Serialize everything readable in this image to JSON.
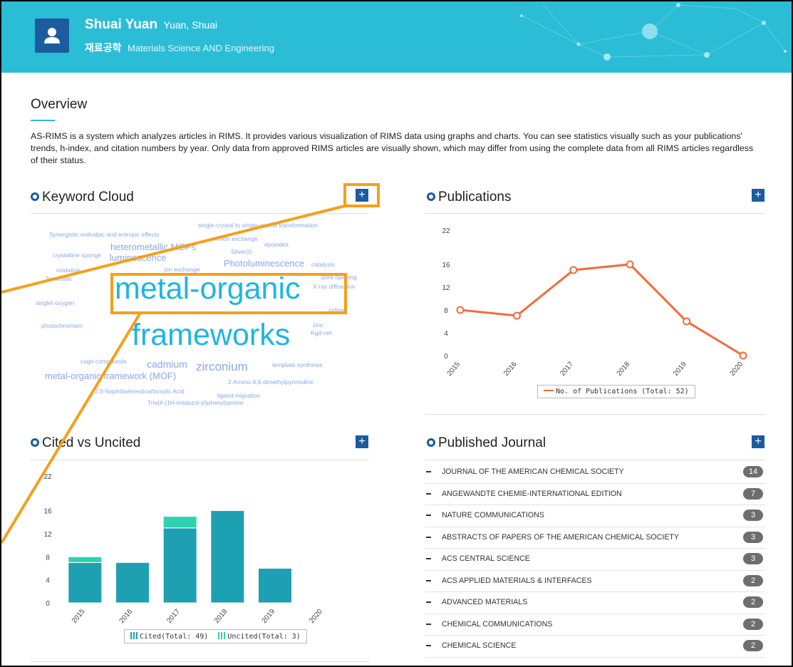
{
  "header": {
    "name": "Shuai Yuan",
    "name_alt": "Yuan, Shuai",
    "dept_kr": "재료공학",
    "dept_en": "Materials Science AND Engineering",
    "avatar_icon": "user-icon",
    "background_color": "#2cbdd6"
  },
  "overview": {
    "title": "Overview",
    "text": "AS-RIMS is a system which analyzes articles in RIMS. It provides various visualization of RIMS data using graphs and charts. You can see statistics visually such as your publications' trends, h-index, and citation numbers by year. Only data from approved RIMS articles are visually shown, which may differ from using the complete data from all RIMS articles regardless of their status."
  },
  "panels": {
    "keyword_cloud": {
      "title": "Keyword Cloud",
      "expand_label": "+"
    },
    "publications": {
      "title": "Publications",
      "expand_label": "+"
    },
    "cited": {
      "title": "Cited vs Uncited",
      "expand_label": "+"
    },
    "journal": {
      "title": "Published Journal",
      "expand_label": "+"
    }
  },
  "keywords": [
    "metal-organic",
    "frameworks",
    "Synergistic enthalpic and entropic effects",
    "single-crystal to single-crystal transformation",
    "Anion exchange",
    "epoxides",
    "heterometallic MOFs",
    "Silver(I)",
    "crystalline sponge",
    "luminescence",
    "Photoluminescence",
    "catalysis",
    "oxidation",
    "ion exchange",
    "fenamate",
    "pore opening",
    "X-ray diffraction",
    "singlet oxygen",
    "iodine",
    "photochromism",
    "zinc",
    "Kgd net",
    "cage compounds",
    "cadmium",
    "zirconium",
    "template synthesis",
    "metal-organic framework (MOF)",
    "2-Amino-4,6-dimethylpyrimidine",
    "2,6-Naphthalenedicarboxylic Acid",
    "ligand migration",
    "Tris(4-(1H-imidazol-yl)phenyl)amine"
  ],
  "journals": [
    {
      "name": "JOURNAL OF THE AMERICAN CHEMICAL SOCIETY",
      "count": "14"
    },
    {
      "name": "ANGEWANDTE CHEMIE-INTERNATIONAL EDITION",
      "count": "7"
    },
    {
      "name": "NATURE COMMUNICATIONS",
      "count": "3"
    },
    {
      "name": "ABSTRACTS OF PAPERS OF THE AMERICAN CHEMICAL SOCIETY",
      "count": "3"
    },
    {
      "name": "ACS CENTRAL SCIENCE",
      "count": "3"
    },
    {
      "name": "ACS APPLIED MATERIALS & INTERFACES",
      "count": "2"
    },
    {
      "name": "ADVANCED MATERIALS",
      "count": "2"
    },
    {
      "name": "CHEMICAL COMMUNICATIONS",
      "count": "2"
    },
    {
      "name": "CHEMICAL SCIENCE",
      "count": "2"
    }
  ],
  "chart_data": [
    {
      "type": "line",
      "title": "Publications",
      "categories": [
        "2015",
        "2016",
        "2017",
        "2018",
        "2019",
        "2020"
      ],
      "series": [
        {
          "name": "No. of Publications (Total: 52)",
          "values": [
            8,
            7,
            15,
            16,
            6,
            0
          ],
          "color": "#f26b3a"
        }
      ],
      "yticks": [
        0,
        4,
        8,
        12,
        16,
        22
      ],
      "ylim": [
        0,
        22
      ],
      "grid": false,
      "legend": "bottom"
    },
    {
      "type": "bar",
      "stacked": true,
      "title": "Cited vs Uncited",
      "categories": [
        "2015",
        "2016",
        "2017",
        "2018",
        "2019",
        "2020"
      ],
      "series": [
        {
          "name": "Cited(Total: 49)",
          "values": [
            7,
            7,
            13,
            16,
            6,
            0
          ],
          "color": "#1ea0b3"
        },
        {
          "name": "Uncited(Total: 3)",
          "values": [
            1,
            0,
            2,
            0,
            0,
            0
          ],
          "color": "#2fd1b0"
        }
      ],
      "yticks": [
        0,
        4,
        8,
        12,
        16,
        22
      ],
      "ylim": [
        0,
        22
      ],
      "grid": false,
      "legend": "bottom"
    }
  ],
  "colors": {
    "accent": "#2cbdd6",
    "button": "#1c5c9e",
    "callout": "#f5a01b",
    "keyword_highlight": "#1fb5e3",
    "keyword_normal": "#8aa7e8"
  }
}
